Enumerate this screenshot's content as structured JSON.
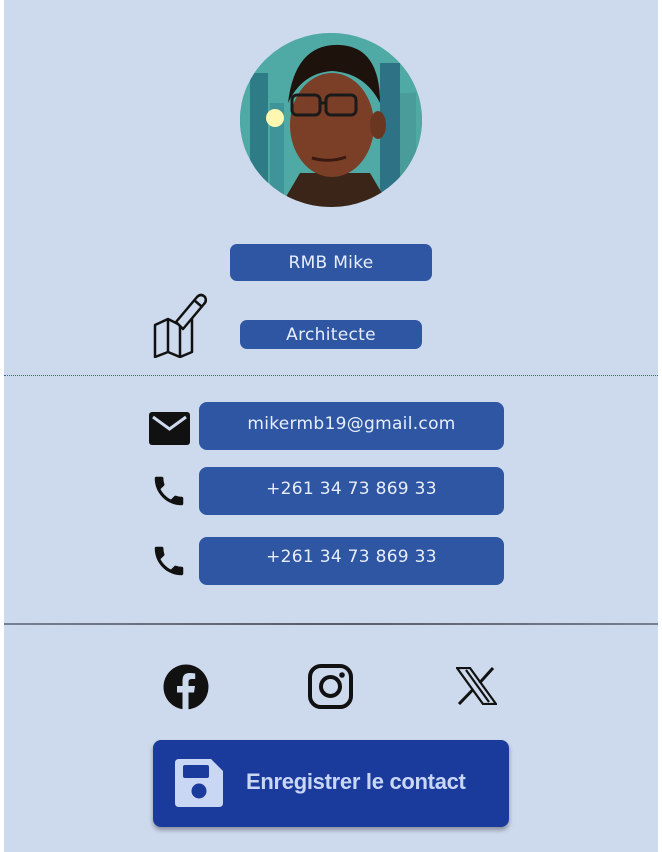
{
  "profile": {
    "name": "RMB Mike",
    "job_title": "Architecte",
    "avatar_icon": "profile-photo"
  },
  "contacts": {
    "email": "mikermb19@gmail.com",
    "phone_1": "+261 34 73 869 33",
    "phone_2": "+261 34 73 869 33"
  },
  "social": {
    "items": [
      "facebook-icon",
      "instagram-icon",
      "x-icon"
    ]
  },
  "actions": {
    "save_label": "Enregistrer le contact"
  },
  "colors": {
    "background": "#cdd9ed",
    "pill": "#2f56a3",
    "button": "#1a3b9c"
  }
}
